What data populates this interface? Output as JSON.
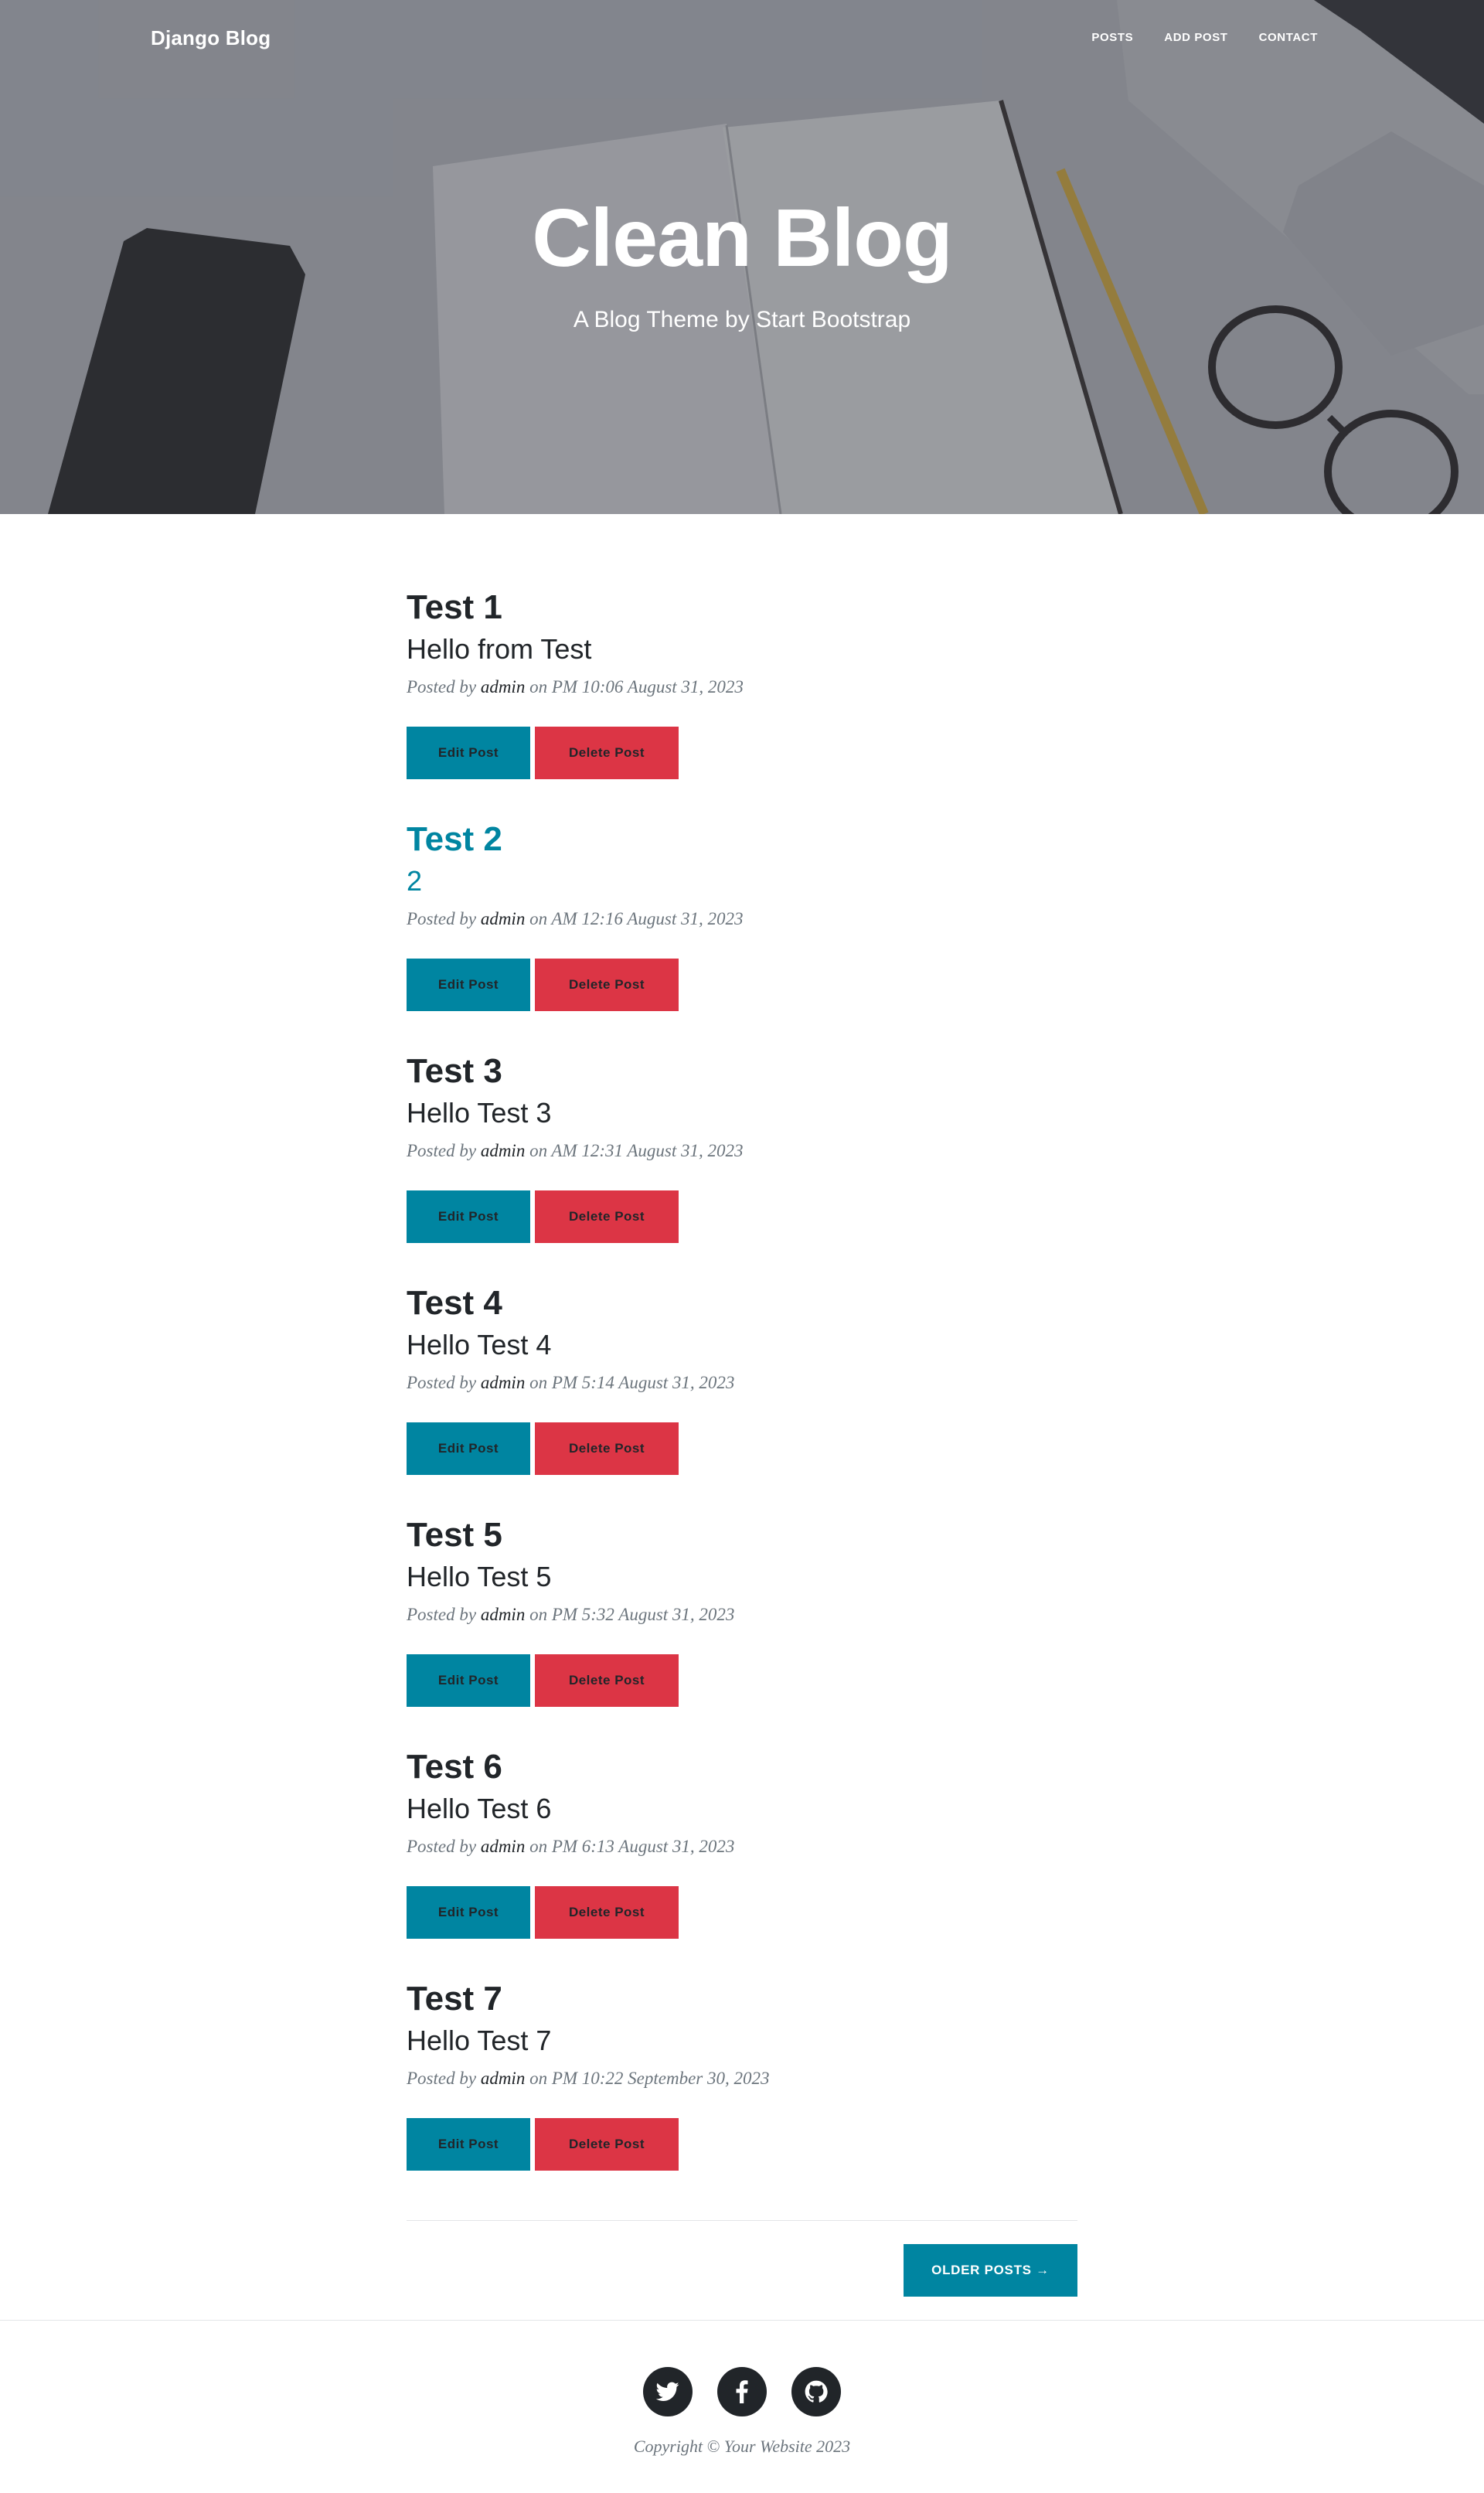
{
  "nav": {
    "brand": "Django Blog",
    "links": [
      {
        "label": "Posts"
      },
      {
        "label": "Add Post"
      },
      {
        "label": "Contact"
      }
    ]
  },
  "masthead": {
    "title": "Clean Blog",
    "subtitle": "A Blog Theme by Start Bootstrap"
  },
  "posts": [
    {
      "title": "Test 1",
      "subtitle": "Hello from Test",
      "author": "admin",
      "date": "PM 10:06 August 31, 2023",
      "edit_label": "Edit Post",
      "delete_label": "Delete Post"
    },
    {
      "title": "Test 2",
      "subtitle": "2",
      "author": "admin",
      "date": "AM 12:16 August 31, 2023",
      "edit_label": "Edit Post",
      "delete_label": "Delete Post"
    },
    {
      "title": "Test 3",
      "subtitle": "Hello Test 3",
      "author": "admin",
      "date": "AM 12:31 August 31, 2023",
      "edit_label": "Edit Post",
      "delete_label": "Delete Post"
    },
    {
      "title": "Test 4",
      "subtitle": "Hello Test 4",
      "author": "admin",
      "date": "PM 5:14 August 31, 2023",
      "edit_label": "Edit Post",
      "delete_label": "Delete Post"
    },
    {
      "title": "Test 5",
      "subtitle": "Hello Test 5",
      "author": "admin",
      "date": "PM 5:32 August 31, 2023",
      "edit_label": "Edit Post",
      "delete_label": "Delete Post"
    },
    {
      "title": "Test 6",
      "subtitle": "Hello Test 6",
      "author": "admin",
      "date": "PM 6:13 August 31, 2023",
      "edit_label": "Edit Post",
      "delete_label": "Delete Post"
    },
    {
      "title": "Test 7",
      "subtitle": "Hello Test 7",
      "author": "admin",
      "date": "PM 10:22 September 30, 2023",
      "edit_label": "Edit Post",
      "delete_label": "Delete Post"
    }
  ],
  "meta_prefix": "Posted by",
  "meta_on": "on",
  "pager": {
    "older_label": "Older Posts →"
  },
  "footer": {
    "social_icons": [
      "twitter-icon",
      "facebook-icon",
      "github-icon"
    ],
    "copyright": "Copyright © Your Website 2023"
  },
  "colors": {
    "accent": "#0085a1",
    "danger": "#dc3545",
    "text": "#212529",
    "muted": "#6c757d"
  }
}
